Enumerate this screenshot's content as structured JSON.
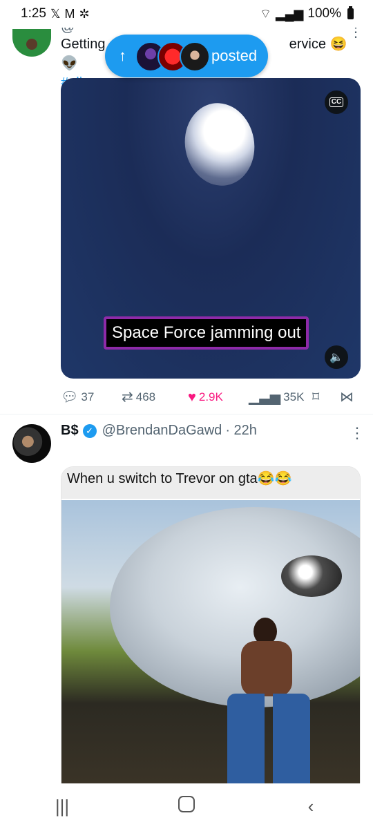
{
  "status_bar": {
    "time": "1:25",
    "left_icons": [
      "x-logo-icon",
      "gmail-icon",
      "fan-icon"
    ],
    "battery": "100%"
  },
  "tweet1": {
    "handle_partial": "@",
    "text_start": "Getting",
    "text_end": "ervice",
    "emoji": "😆👽",
    "hashtag": "#alien",
    "video_caption": "Space Force jamming out",
    "cc_label": "CC",
    "actions": {
      "replies": "37",
      "reposts": "468",
      "likes": "2.9K",
      "views": "35K"
    },
    "like_color": "#f91880"
  },
  "posted_pill": {
    "arrow": "↑",
    "label": "posted"
  },
  "tweet2": {
    "name": "B$",
    "handle": "@BrendanDaGawd",
    "time": "· 22h",
    "meme_caption": "When u switch to Trevor on gta",
    "meme_emoji": "😂😂"
  },
  "colors": {
    "accent": "#1d9bf0",
    "muted": "#536471"
  }
}
